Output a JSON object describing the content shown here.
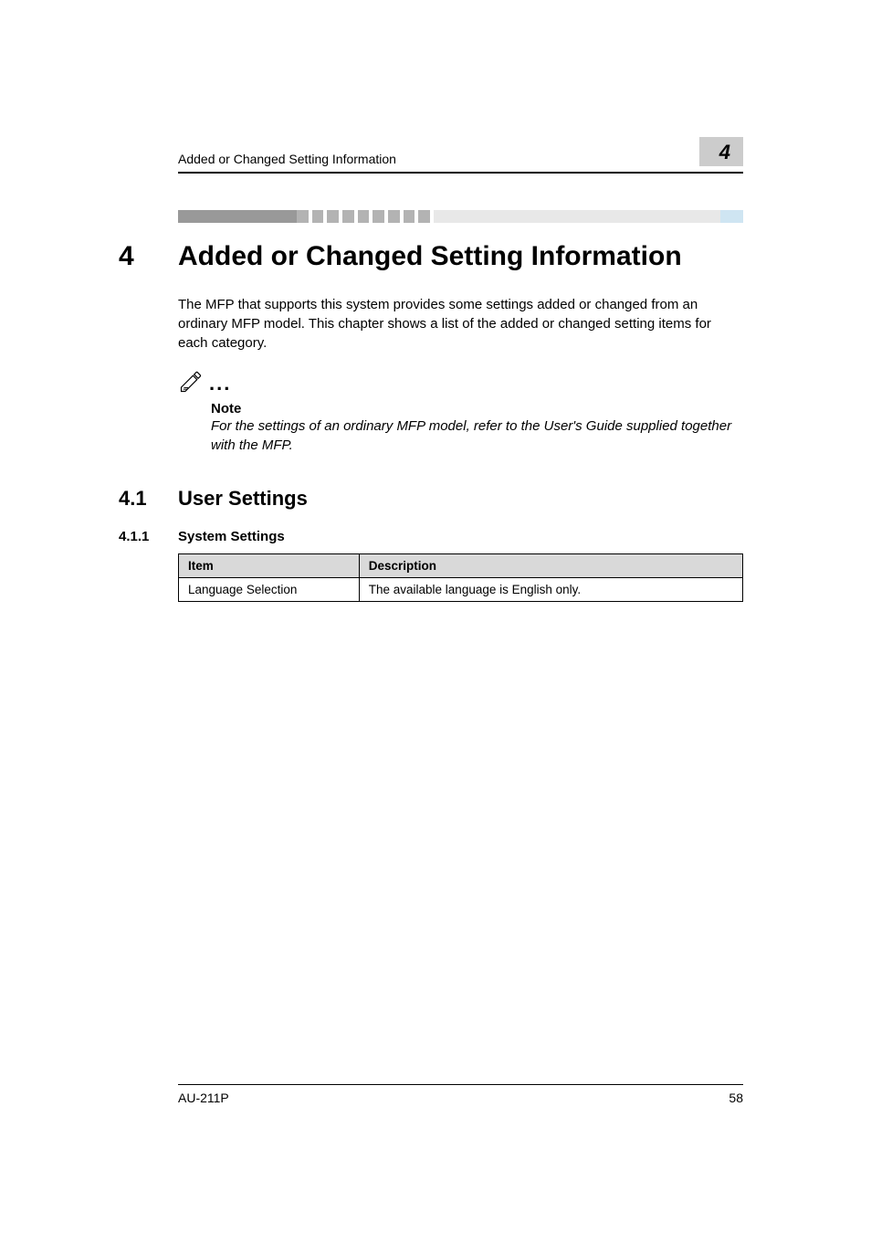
{
  "header": {
    "running_head": "Added or Changed Setting Information",
    "number_box": "4"
  },
  "chapter": {
    "num": "4",
    "title": "Added or Changed Setting Information"
  },
  "intro": "The MFP that supports this system provides some settings added or changed from an ordinary MFP model. This chapter shows a list of the added or changed setting items for each category.",
  "note": {
    "label": "Note",
    "text": "For the settings of an ordinary MFP model, refer to the User's Guide supplied together with the MFP."
  },
  "section": {
    "num": "4.1",
    "title": "User Settings"
  },
  "subsection": {
    "num": "4.1.1",
    "title": "System Settings"
  },
  "table": {
    "headers": {
      "col1": "Item",
      "col2": "Description"
    },
    "row": {
      "col1": "Language Selection",
      "col2": "The available language is English only."
    }
  },
  "footer": {
    "left": "AU-211P",
    "right": "58"
  }
}
